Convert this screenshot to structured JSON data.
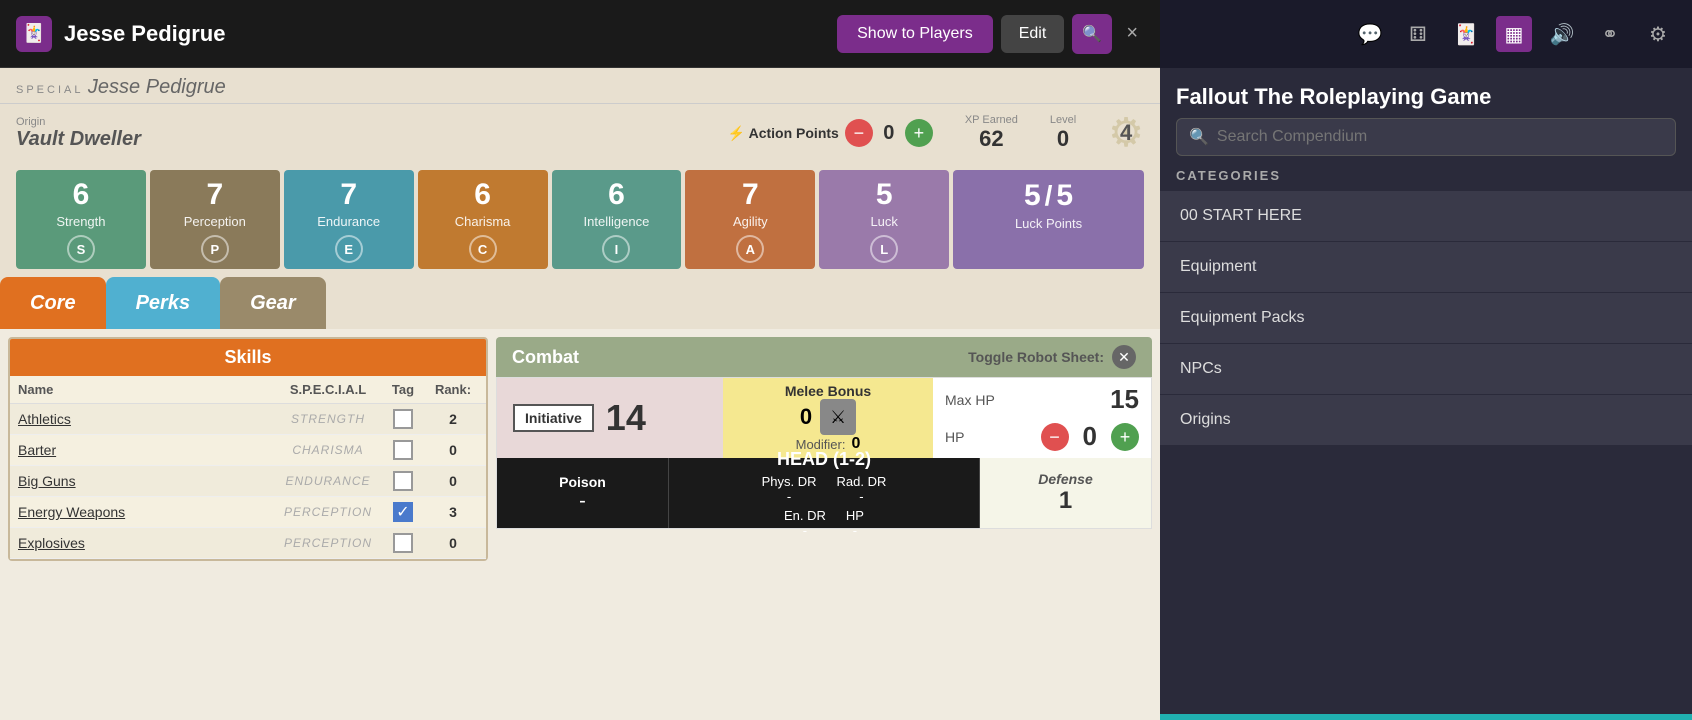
{
  "app": {
    "logo": "🃏",
    "title": "Jesse Pedigrue"
  },
  "header": {
    "show_players_label": "Show to Players",
    "edit_label": "Edit",
    "search_icon": "🔍",
    "close_label": "×"
  },
  "character": {
    "special_label": "SPECIAL",
    "name_top": "Jesse Pedigrue",
    "origin_label": "Origin",
    "origin_value": "Vault Dweller",
    "action_points_label": "⚡ Action Points",
    "ap_value": "0",
    "xp_label": "XP Earned",
    "xp_value": "62",
    "level_label": "Level",
    "level_value": "0",
    "gear_number": "4"
  },
  "stats": [
    {
      "id": "strength",
      "label": "Strength",
      "value": "6",
      "badge": "S",
      "class": "strength"
    },
    {
      "id": "perception",
      "label": "Perception",
      "value": "7",
      "badge": "P",
      "class": "perception"
    },
    {
      "id": "endurance",
      "label": "Endurance",
      "value": "7",
      "badge": "E",
      "class": "endurance"
    },
    {
      "id": "charisma",
      "label": "Charisma",
      "value": "6",
      "badge": "C",
      "class": "charisma"
    },
    {
      "id": "intelligence",
      "label": "Intelligence",
      "value": "6",
      "badge": "I",
      "class": "intelligence"
    },
    {
      "id": "agility",
      "label": "Agility",
      "value": "7",
      "badge": "A",
      "class": "agility"
    },
    {
      "id": "luck",
      "label": "Luck",
      "value": "5",
      "badge": "L",
      "class": "luck"
    },
    {
      "id": "luck-points",
      "label": "Luck Points",
      "value1": "5",
      "slash": "/",
      "value2": "5",
      "class": "luck-points"
    }
  ],
  "tabs": [
    {
      "id": "core",
      "label": "Core",
      "class": "core"
    },
    {
      "id": "perks",
      "label": "Perks",
      "class": "perks"
    },
    {
      "id": "gear",
      "label": "Gear",
      "class": "gear"
    }
  ],
  "skills": {
    "header": "Skills",
    "col_name": "Name",
    "col_special": "S.P.E.C.I.A.L",
    "col_tag": "Tag",
    "col_rank": "Rank:",
    "rows": [
      {
        "name": "Athletics",
        "special": "STRENGTH",
        "tagged": false,
        "rank": "2"
      },
      {
        "name": "Barter",
        "special": "CHARISMA",
        "tagged": false,
        "rank": "0"
      },
      {
        "name": "Big Guns",
        "special": "ENDURANCE",
        "tagged": false,
        "rank": "0"
      },
      {
        "name": "Energy Weapons",
        "special": "PERCEPTION",
        "tagged": true,
        "rank": "3"
      },
      {
        "name": "Explosives",
        "special": "PERCEPTION",
        "tagged": false,
        "rank": "0"
      }
    ]
  },
  "combat": {
    "header": "Combat",
    "toggle_label": "Toggle Robot Sheet:",
    "initiative_label": "Initiative",
    "initiative_value": "14",
    "melee_bonus_label": "Melee Bonus",
    "melee_bonus_value": "0",
    "modifier_label": "Modifier:",
    "modifier_value": "0",
    "max_hp_label": "Max HP",
    "max_hp_value": "15",
    "hp_label": "HP",
    "hp_value": "0",
    "poison_label": "Poison",
    "poison_value": "-",
    "head_label": "HEAD (1-2)",
    "phys_dr_label": "Phys. DR",
    "phys_dr_value": "-",
    "rad_dr_label": "Rad. DR",
    "rad_dr_value": "-",
    "en_dr_label": "En. DR",
    "en_dr_value": "-",
    "hp_loc_label": "HP",
    "defense_label": "Defense",
    "defense_value": "1"
  },
  "compendium": {
    "title": "Fallout The Roleplaying Game",
    "search_placeholder": "Search Compendium",
    "categories_label": "CATEGORIES",
    "categories": [
      {
        "id": "start-here",
        "label": "00 START HERE"
      },
      {
        "id": "equipment",
        "label": "Equipment"
      },
      {
        "id": "equipment-packs",
        "label": "Equipment Packs"
      },
      {
        "id": "npcs",
        "label": "NPCs"
      },
      {
        "id": "origins",
        "label": "Origins"
      }
    ]
  },
  "toolbar_icons": [
    {
      "id": "chat",
      "symbol": "💬"
    },
    {
      "id": "dice",
      "symbol": "⚅"
    },
    {
      "id": "cards",
      "symbol": "🃏",
      "active": true
    },
    {
      "id": "sound",
      "symbol": "🔊"
    },
    {
      "id": "users",
      "symbol": "👥"
    },
    {
      "id": "settings",
      "symbol": "⚙"
    }
  ]
}
